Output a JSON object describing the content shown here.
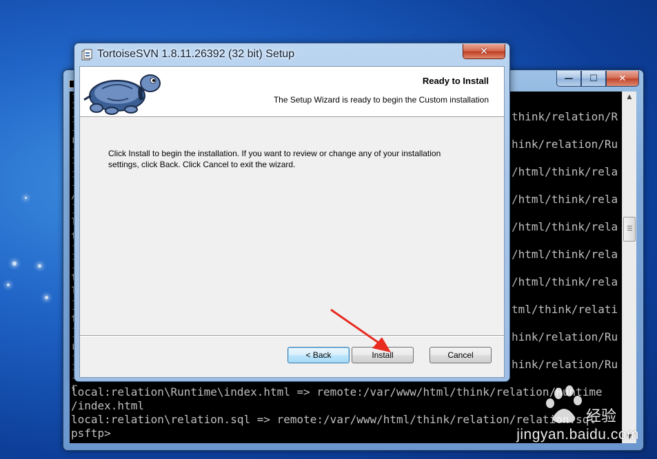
{
  "desktop": {
    "watermark_text": "jingyan.baidu.com"
  },
  "console": {
    "caption_minimize": "—",
    "caption_maximize": "☐",
    "caption_close": "✕",
    "left_chars": [
      "]",
      "]",
      "]",
      "r",
      "]",
      "]",
      "]",
      "/",
      "]",
      "l",
      "t",
      "]",
      "]",
      "t",
      "l",
      "]",
      "t",
      "]",
      "r",
      "]",
      "]",
      "r"
    ],
    "right_column": [
      "think/relation/R",
      "hink/relation/Ru",
      "/html/think/rela",
      "/html/think/rela",
      "/html/think/rela",
      "/html/think/rela",
      "/html/think/rela",
      "tml/think/relati",
      "hink/relation/Ru",
      "hink/relation/Ru"
    ],
    "bottom_lines": [
      "local:relation\\Runtime\\index.html => remote:/var/www/html/think/relation/Runtime",
      "/index.html",
      "local:relation\\relation.sql => remote:/var/www/html/think/relation/relation.sql",
      "psftp>"
    ]
  },
  "setup": {
    "title": "TortoiseSVN 1.8.11.26392 (32 bit) Setup",
    "close_label": "✕",
    "banner_title": "Ready to Install",
    "banner_subtitle": "The Setup Wizard is ready to begin the Custom installation",
    "body_line1": "Click Install to begin the installation. If you want to review or change any of your installation",
    "body_line2": "settings, click Back. Click Cancel to exit the wizard.",
    "back_label": "< Back",
    "install_label": "Install",
    "cancel_label": "Cancel"
  }
}
